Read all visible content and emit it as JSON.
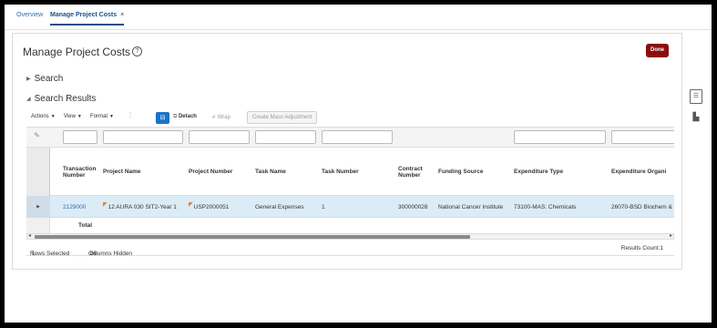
{
  "tabs": [
    {
      "label": "Overview"
    },
    {
      "label": "Manage Project Costs",
      "close": "×"
    }
  ],
  "page": {
    "title": "Manage Project Costs",
    "help_icon": "help-icon",
    "done_label": "Done"
  },
  "sections": {
    "search": "Search",
    "search_results": "Search Results"
  },
  "toolbar": {
    "actions": "Actions",
    "view": "View",
    "format": "Format",
    "detach": "Detach",
    "wrap": "Wrap",
    "mass_adjustment": "Create Mass Adjustment"
  },
  "table": {
    "columns": [
      "Transaction Number",
      "Project Name",
      "Project Number",
      "Task Name",
      "Task Number",
      "Contract Number",
      "Funding Source",
      "Expenditure Type",
      "Expenditure Organi"
    ],
    "row": {
      "transaction_number": "2129000",
      "project_name": "12 AURA 030 SIT2-Year 1",
      "project_number": "USP2000051",
      "task_name": "General Expenses",
      "task_number": "1",
      "contract_number": "300000028",
      "funding_source": "National Cancer Institute",
      "expenditure_type": "73100-MAS: Chemicals",
      "expenditure_organization": "26070-BSD Biochem &"
    },
    "total_label": "Total"
  },
  "status": {
    "rows_selected_label": "Rows Selected",
    "rows_selected": "1",
    "columns_hidden_label": "Columns Hidden",
    "columns_hidden": "86",
    "results_count": "Results Count:1"
  },
  "colors": {
    "accent": "#1a73c7",
    "done": "#8b0d0d",
    "selected_row": "#dcecf7"
  }
}
